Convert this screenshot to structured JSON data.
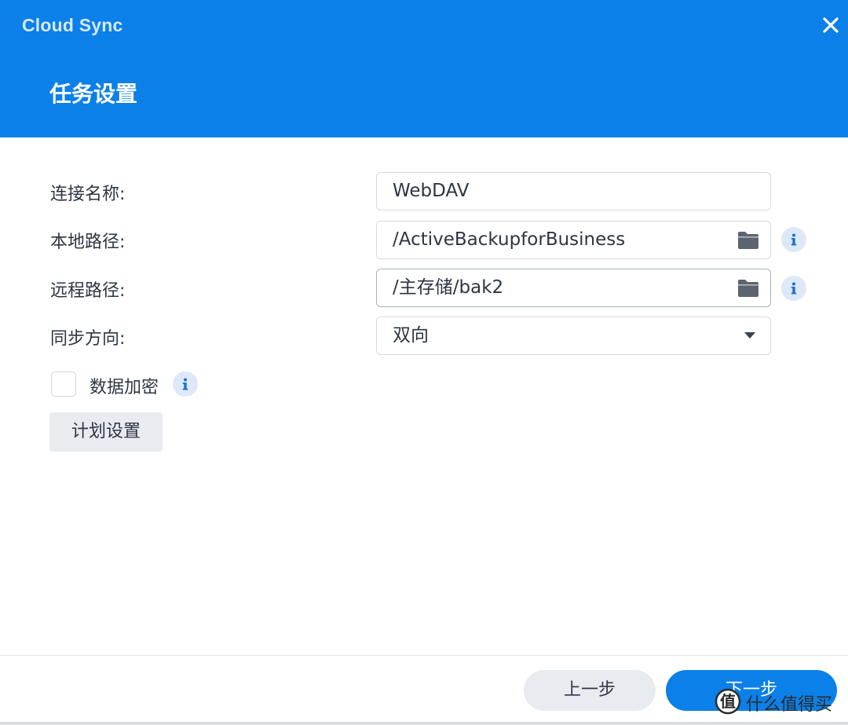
{
  "window": {
    "app_title": "Cloud Sync",
    "page_title": "任务设置",
    "accent_color": "#0a80e8"
  },
  "form": {
    "connection_name": {
      "label": "连接名称:",
      "value": "WebDAV"
    },
    "local_path": {
      "label": "本地路径:",
      "value": "/ActiveBackupforBusiness",
      "icon": "folder-icon"
    },
    "remote_path": {
      "label": "远程路径:",
      "value": "/主存储/bak2",
      "icon": "folder-icon"
    },
    "sync_direction": {
      "label": "同步方向:",
      "value": "双向",
      "icon": "caret-down-icon"
    },
    "encryption": {
      "label": "数据加密",
      "checked": false
    },
    "schedule_button": "计划设置"
  },
  "footer": {
    "prev_label": "上一步",
    "next_label": "下一步"
  },
  "watermark": {
    "text": "什么值得买"
  }
}
